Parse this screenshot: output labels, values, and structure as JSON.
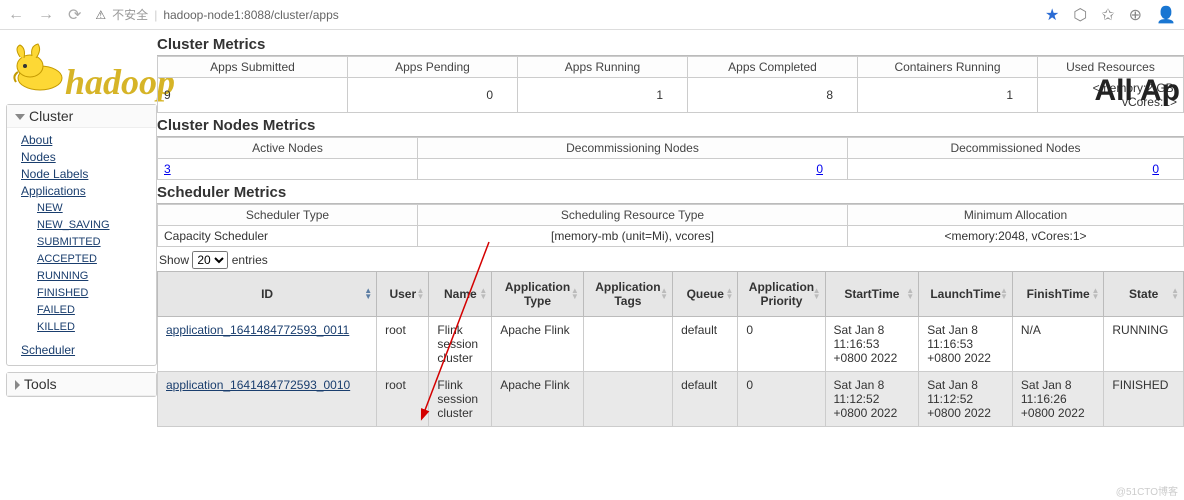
{
  "browser": {
    "security": "不安全",
    "url": "hadoop-node1:8088/cluster/apps",
    "star": "★"
  },
  "pageTitle": "All Ap",
  "sidebar": {
    "cluster": "Cluster",
    "links": {
      "about": "About",
      "nodes": "Nodes",
      "node_labels": "Node Labels",
      "applications": "Applications"
    },
    "states": {
      "new": "NEW",
      "new_saving": "NEW_SAVING",
      "submitted": "SUBMITTED",
      "accepted": "ACCEPTED",
      "running": "RUNNING",
      "finished": "FINISHED",
      "failed": "FAILED",
      "killed": "KILLED"
    },
    "scheduler": "Scheduler",
    "tools": "Tools"
  },
  "sections": {
    "cm": "Cluster Metrics",
    "cnm": "Cluster Nodes Metrics",
    "sm": "Scheduler Metrics"
  },
  "clusterMetrics": {
    "headers": {
      "submitted": "Apps Submitted",
      "pending": "Apps Pending",
      "running": "Apps Running",
      "completed": "Apps Completed",
      "containers": "Containers Running",
      "used": "Used Resources"
    },
    "values": {
      "submitted": "9",
      "pending": "0",
      "running": "1",
      "completed": "8",
      "containers": "1",
      "used": "<memory:2 GB, vCores:1>"
    }
  },
  "nodesMetrics": {
    "headers": {
      "active": "Active Nodes",
      "decommissioning": "Decommissioning Nodes",
      "decommissioned": "Decommissioned Nodes"
    },
    "values": {
      "active": "3",
      "decommissioning": "0",
      "decommissioned": "0"
    }
  },
  "schedulerMetrics": {
    "headers": {
      "type": "Scheduler Type",
      "resource": "Scheduling Resource Type",
      "min": "Minimum Allocation"
    },
    "values": {
      "type": "Capacity Scheduler",
      "resource": "[memory-mb (unit=Mi), vcores]",
      "min": "<memory:2048, vCores:1>"
    }
  },
  "show": {
    "prefix": "Show",
    "count": "20",
    "suffix": "entries"
  },
  "gridHeaders": {
    "id": "ID",
    "user": "User",
    "name": "Name",
    "apptype": "Application Type",
    "apptags": "Application Tags",
    "queue": "Queue",
    "priority": "Application Priority",
    "start": "StartTime",
    "launch": "LaunchTime",
    "finish": "FinishTime",
    "state": "State"
  },
  "rows": [
    {
      "id": "application_1641484772593_0011",
      "user": "root",
      "name": "Flink session cluster",
      "apptype": "Apache Flink",
      "apptags": "",
      "queue": "default",
      "priority": "0",
      "start": "Sat Jan 8 11:16:53 +0800 2022",
      "launch": "Sat Jan 8 11:16:53 +0800 2022",
      "finish": "N/A",
      "state": "RUNNING"
    },
    {
      "id": "application_1641484772593_0010",
      "user": "root",
      "name": "Flink session cluster",
      "apptype": "Apache Flink",
      "apptags": "",
      "queue": "default",
      "priority": "0",
      "start": "Sat Jan 8 11:12:52 +0800 2022",
      "launch": "Sat Jan 8 11:12:52 +0800 2022",
      "finish": "Sat Jan 8 11:16:26 +0800 2022",
      "state": "FINISHED"
    }
  ],
  "watermark": "@51CTO博客"
}
